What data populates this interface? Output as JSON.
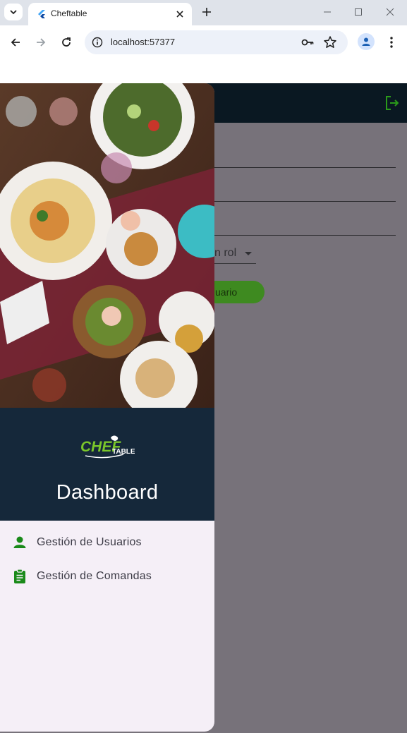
{
  "browser": {
    "tab_title": "Cheftable",
    "url": "localhost:57377"
  },
  "app": {
    "role_select_text": "n rol",
    "create_button_text": "uario"
  },
  "drawer": {
    "logo_text_main": "CHEF",
    "logo_text_sub": "TABLE",
    "title": "Dashboard",
    "items": [
      {
        "label": "Gestión de Usuarios",
        "icon": "person-icon"
      },
      {
        "label": "Gestión de Comandas",
        "icon": "clipboard-icon"
      }
    ]
  },
  "colors": {
    "accent_green": "#1a8a1a",
    "header_navy": "#15283a",
    "scrim_gray": "#77727a"
  }
}
